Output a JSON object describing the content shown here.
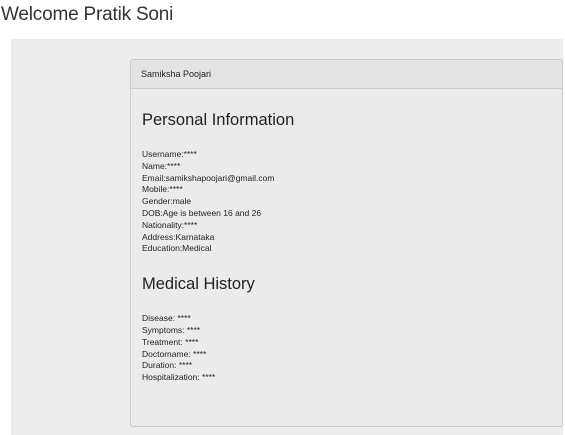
{
  "header": {
    "welcome": "Welcome Pratik Soni"
  },
  "panel": {
    "heading": "Samiksha Poojari",
    "personal": {
      "title": "Personal Information",
      "fields": [
        "Username:****",
        "Name:****",
        "Email:samikshapoojari@gmail.com",
        "Mobile:****",
        "Gender:male",
        "DOB:Age is between 16 and 26",
        "Nationality:****",
        "Address:Karnataka",
        "Education:Medical"
      ]
    },
    "medical": {
      "title": "Medical History",
      "fields": [
        "Disease: ****",
        "Symptoms: ****",
        "Treatment: ****",
        "Doctorname: ****",
        "Duration: ****",
        "Hospitalization: ****"
      ]
    }
  }
}
